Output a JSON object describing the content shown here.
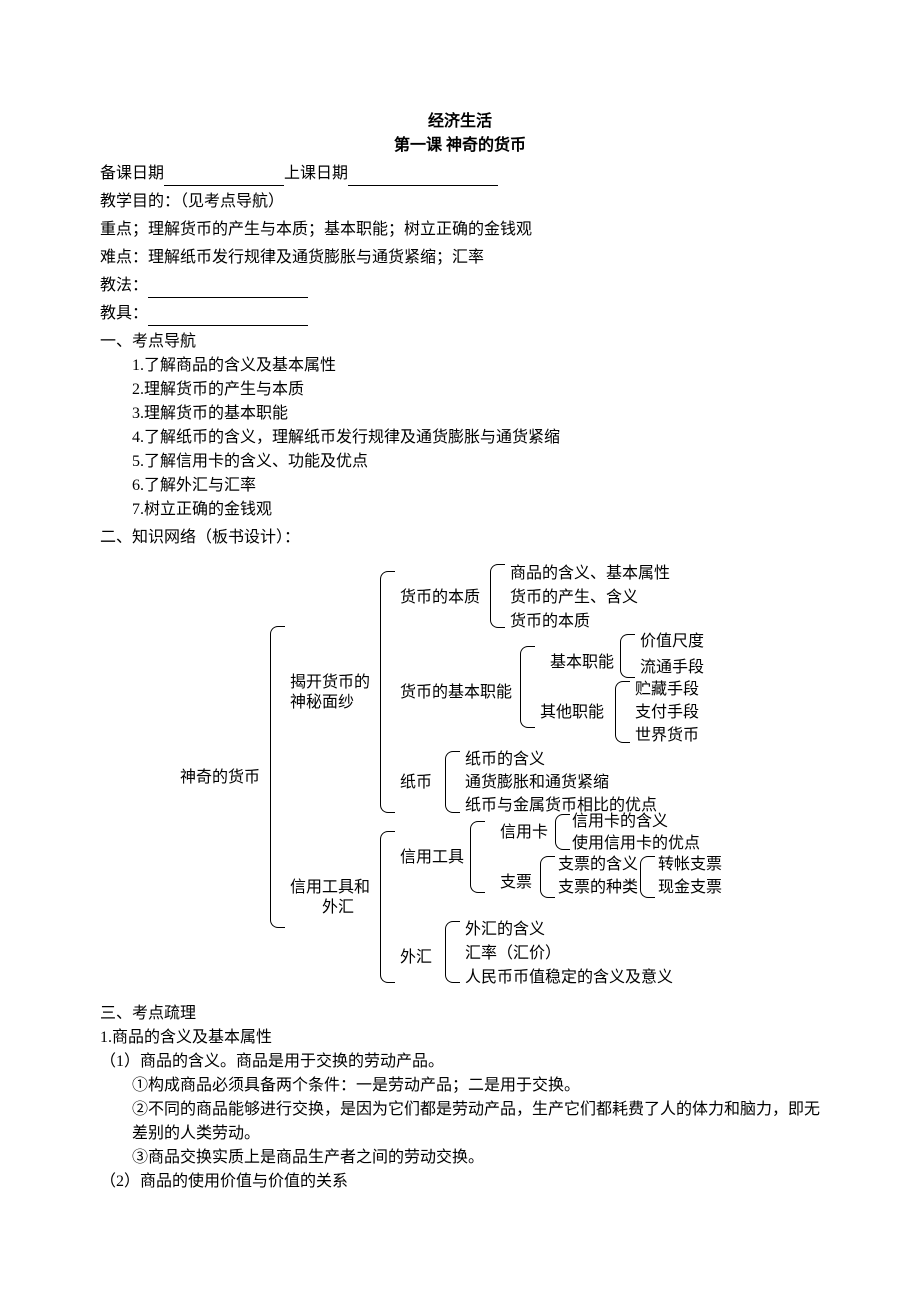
{
  "title1": "经济生活",
  "title2": "第一课  神奇的货币",
  "meta": {
    "prepDateLabel": "备课日期",
    "teachDateLabel": "上课日期",
    "objectiveLabel": "教学目的：（见考点导航）",
    "keyLabel": "重点；理解货币的产生与本质；基本职能；树立正确的金钱观",
    "diffLabel": "难点：理解纸币发行规律及通货膨胀与通货紧缩；汇率",
    "methodLabel": "教法：",
    "toolLabel": "教具："
  },
  "sec1": {
    "heading": "一、考点导航",
    "items": [
      "1.了解商品的含义及基本属性",
      "2.理解货币的产生与本质",
      "3.理解货币的基本职能",
      "4.了解纸币的含义，理解纸币发行规律及通货膨胀与通货紧缩",
      "5.了解信用卡的含义、功能及优点",
      "6.了解外汇与汇率",
      "7.树立正确的金钱观"
    ]
  },
  "sec2": {
    "heading": "二、知识网络（板书设计）：",
    "root": "神奇的货币",
    "a1l1": "揭开货币的",
    "a1l2": "神秘面纱",
    "a2l1": "信用工具和",
    "a2l2": "外汇",
    "b1": "货币的本质",
    "b2": "货币的基本职能",
    "b3": "纸币",
    "b4": "信用工具",
    "b5": "外汇",
    "c1": "商品的含义、基本属性",
    "c2": "货币的产生、含义",
    "c3": "货币的本质",
    "c4": "基本职能",
    "c5": "其他职能",
    "c6": "纸币的含义",
    "c7": "通货膨胀和通货紧缩",
    "c8": "纸币与金属货币相比的优点",
    "c9": "信用卡",
    "c9b": "信用卡的含义",
    "c9c": "使用信用卡的优点",
    "c10": "支票",
    "c10b": "支票的含义",
    "c10c": "支票的种类",
    "c11": "外汇的含义",
    "c12": "汇率（汇价）",
    "c13": "人民币币值稳定的含义及意义",
    "d1": "价值尺度",
    "d2": "流通手段",
    "d3": "贮藏手段",
    "d4": "支付手段",
    "d5": "世界货币",
    "d6": "转帐支票",
    "d7": "现金支票"
  },
  "sec3": {
    "heading": "三、考点疏理",
    "h1": "1.商品的含义及基本属性",
    "p1": "（1）商品的含义。商品是用于交换的劳动产品。",
    "p2": "①构成商品必须具备两个条件：一是劳动产品；二是用于交换。",
    "p3": "②不同的商品能够进行交换，是因为它们都是劳动产品，生产它们都耗费了人的体力和脑力，即无差别的人类劳动。",
    "p4": "③商品交换实质上是商品生产者之间的劳动交换。",
    "p5": "（2）商品的使用价值与价值的关系"
  }
}
